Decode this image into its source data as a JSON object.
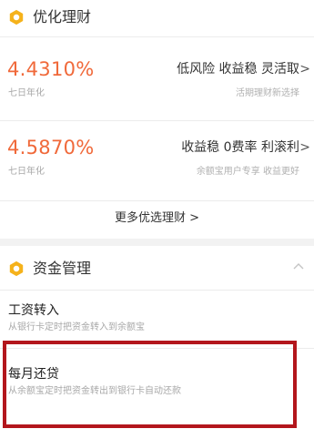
{
  "icons": {
    "section_icon": "hexagon-badge-icon",
    "chevron": "chevron-right-icon",
    "collapse": "chevron-up-icon"
  },
  "colors": {
    "accent_orange": "#f0693a",
    "badge_yellow": "#f5b21b",
    "highlight_red": "#b3161c"
  },
  "finance": {
    "title": "优化理财",
    "products": [
      {
        "rate": "4.4310%",
        "rate_label": "七日年化",
        "tags": "低风险 收益稳 灵活取",
        "chevron": ">",
        "desc": "活期理财新选择"
      },
      {
        "rate": "4.5870%",
        "rate_label": "七日年化",
        "tags": "收益稳 0费率 利滚利",
        "chevron": ">",
        "desc": "余额宝用户专享 收益更好"
      }
    ],
    "more_link": "更多优选理财 >"
  },
  "fund_management": {
    "title": "资金管理",
    "items": [
      {
        "title": "工资转入",
        "desc": "从银行卡定时把资金转入到余额宝"
      },
      {
        "title": "每月还贷",
        "desc": "从余额宝定时把资金转出到银行卡自动还款"
      }
    ]
  }
}
